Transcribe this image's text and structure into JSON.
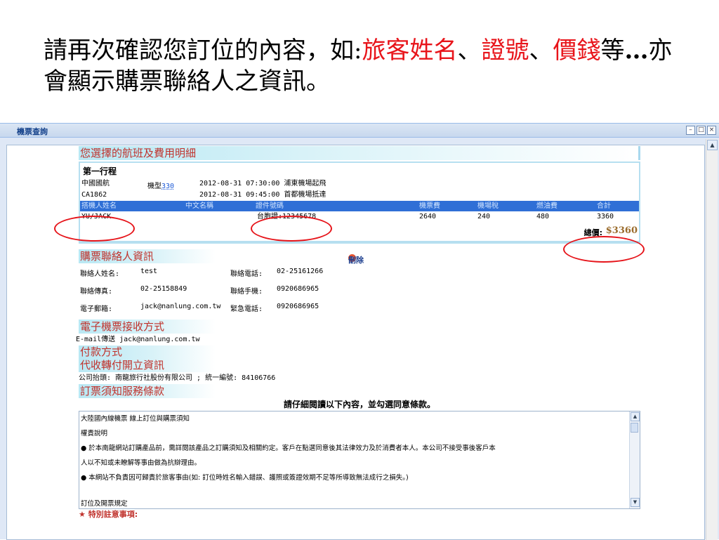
{
  "slide": {
    "title_p1": "請再次確認您訂位的內容，如:",
    "title_r1": "旅客姓名",
    "title_p2": "、",
    "title_r2": "證號",
    "title_p3": "、",
    "title_r3": "價錢",
    "title_p4": "等",
    "title_ell": "…",
    "title_p5": "亦會顯示購票聯絡人之資訊。"
  },
  "window": {
    "title": "機票查詢",
    "ctrl_min": "–",
    "ctrl_max": "□",
    "ctrl_close": "×",
    "scroll_up": "▲"
  },
  "flight": {
    "section_title": "您選擇的航班及費用明細",
    "trip_label": "第一行程",
    "airline": "中國國航",
    "flight_no": "CA1862",
    "model_label": "機型",
    "model_value": "330",
    "depart": "2012-08-31 07:30:00 浦東機場起飛",
    "arrive": "2012-08-31 09:45:00 首都機場抵達",
    "columns": [
      "搭機人姓名",
      "中文名稱",
      "證件號碼",
      "機票費",
      "機場稅",
      "燃油費",
      "合計"
    ],
    "row": [
      "YU/JACK",
      "",
      "台胞證:12345678",
      "2640",
      "240",
      "480",
      "3360"
    ],
    "total_label": "總價:",
    "total_value": "$3360"
  },
  "contact": {
    "section_title": "購票聯絡人資訊",
    "delete_label": "刪除",
    "name_label": "聯絡人姓名:",
    "name_value": "test",
    "phone_label": "聯絡電話:",
    "phone_value": "02-25161266",
    "fax_label": "聯絡傳真:",
    "fax_value": "02-25158849",
    "mobile_label": "聯絡手機:",
    "mobile_value": "0920686965",
    "email_label": "電子郵箱:",
    "email_value": "jack@nanlung.com.tw",
    "urgent_label": "緊急電話:",
    "urgent_value": "0920686965"
  },
  "eticket": {
    "section_title": "電子機票接收方式",
    "line": "E-mail傳送 jack@nanlung.com.tw"
  },
  "payment": {
    "section_title": "付款方式"
  },
  "invoice": {
    "section_title": "代收轉付開立資訊",
    "line": "公司抬頭:  南龍旅行社股份有限公司 ; 統一編號:  84106766"
  },
  "terms": {
    "section_title": "訂票須知服務條款",
    "read_notice": "請仔細閱讀以下內容，並勾選同意條款。",
    "lines": [
      "大陸國內線機票 線上訂位與購票須知",
      "    權責說明",
      "● 於本南龍網站訂購產品前，需詳閱該產品之訂購須知及相關約定。客戶在點選同意後其法律效力及於消費者本人。本公司不接受事後客戶本",
      "人以不知或未瞭解等事由做為抗辯理由。",
      "● 本網站不負責因可歸責於旅客事由(如: 訂位時姓名輸入錯誤、護照或簽證效期不足等所導致無法成行之損失。)",
      "",
      "    訂位及開票規定"
    ],
    "special_label": "特別註意事項:"
  }
}
